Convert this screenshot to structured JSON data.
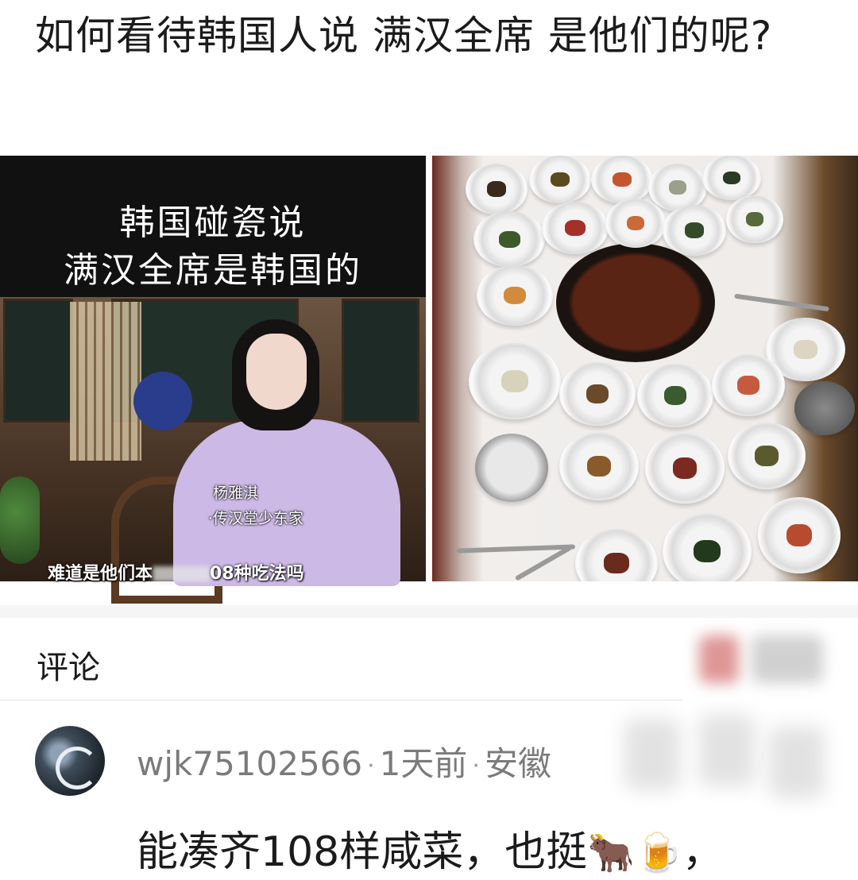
{
  "post": {
    "title": "如何看待韩国人说 满汉全席 是他们的呢?"
  },
  "left_image": {
    "caption_line1": "韩国碰瓷说",
    "caption_line2": "满汉全席是韩国的",
    "name_tag": "杨雅淇",
    "name_subtag": "·传汉堂少东家",
    "subtitle_prefix": "难道是他们本",
    "subtitle_suffix": "08种吃法吗"
  },
  "comments": {
    "section_title": "评论",
    "items": [
      {
        "username": "wjk75102566",
        "time": "1天前",
        "location": "安徽",
        "text": "能凑齐108样咸菜，也挺",
        "trailing_punct": "，",
        "emoji_1": "🐂",
        "emoji_2": "🍺"
      }
    ]
  },
  "icons": [
    "avatar-image",
    "ox-emoji-icon",
    "beer-emoji-icon"
  ]
}
